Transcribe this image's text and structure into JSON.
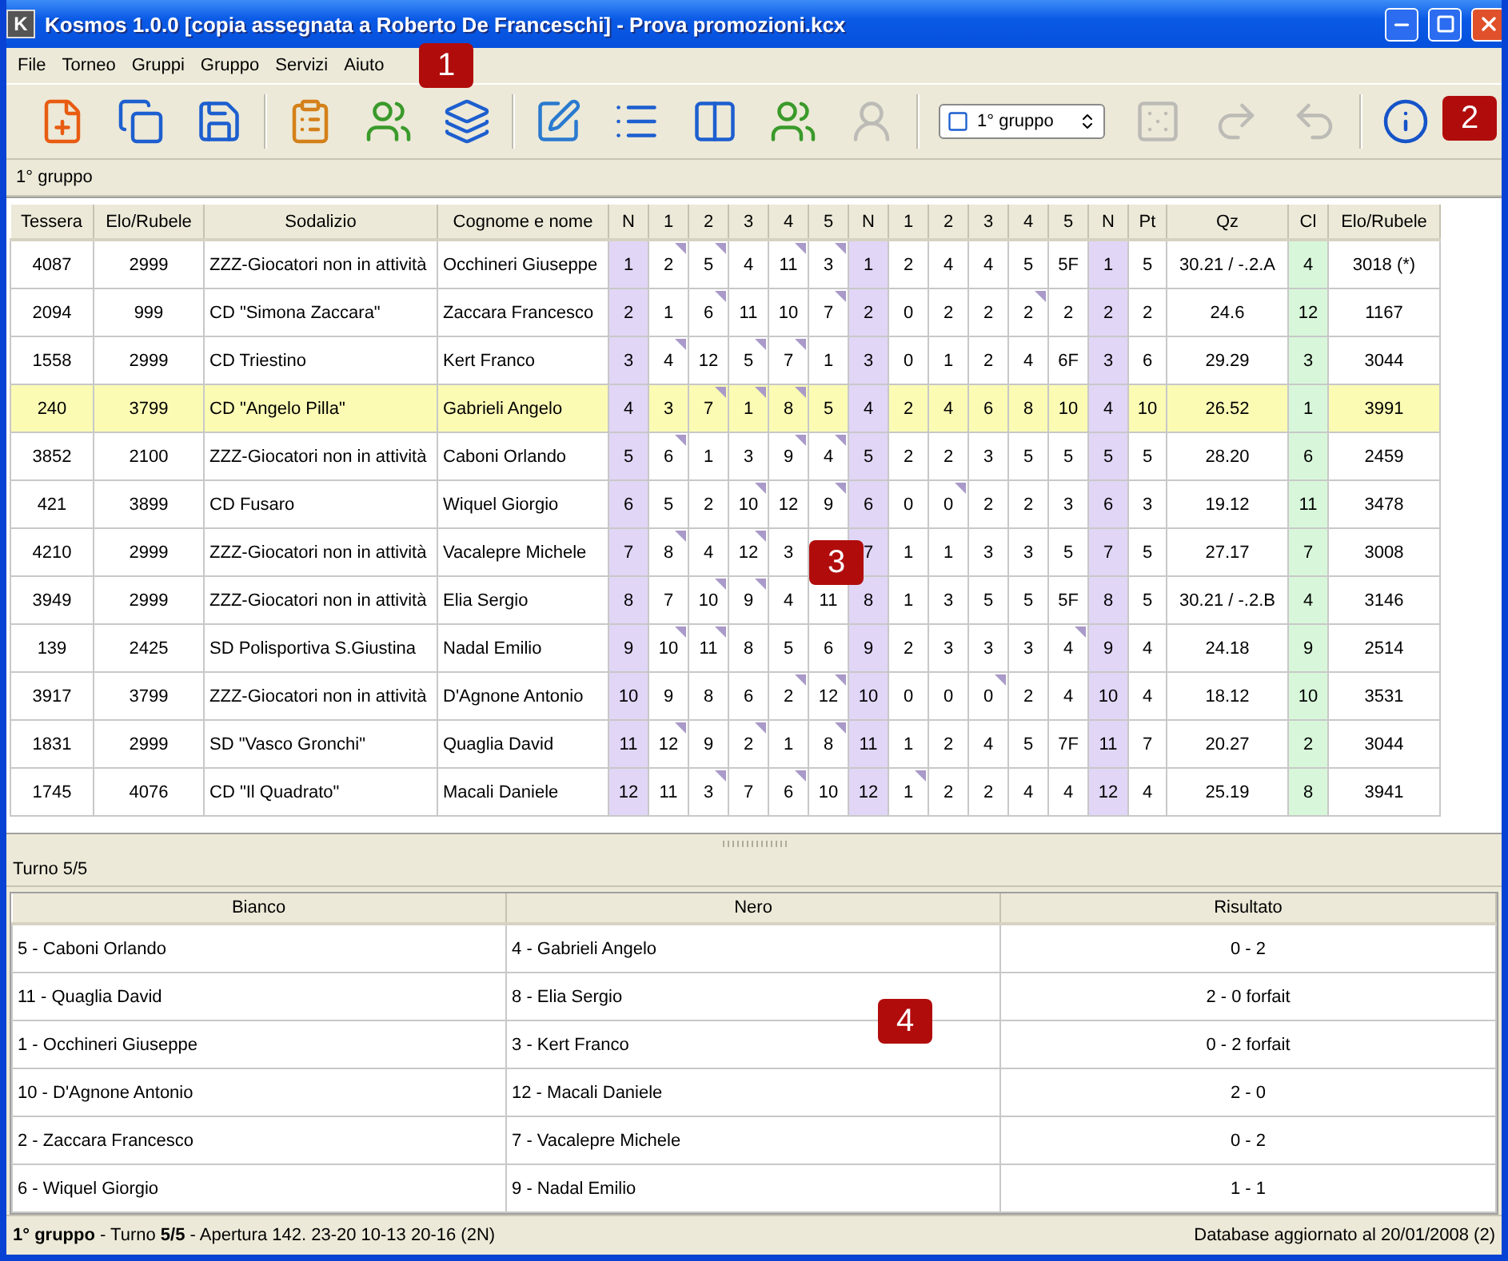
{
  "window": {
    "icon_letter": "K",
    "title": "Kosmos 1.0.0 [copia assegnata a Roberto De Franceschi] - Prova promozioni.kcx"
  },
  "menu": [
    "File",
    "Torneo",
    "Gruppi",
    "Gruppo",
    "Servizi",
    "Aiuto"
  ],
  "toolbar": [
    {
      "kind": "button",
      "disabled": false
    },
    {
      "kind": "button",
      "disabled": false
    },
    {
      "kind": "button",
      "disabled": false
    },
    {
      "kind": "separator"
    },
    {
      "kind": "button",
      "disabled": false
    },
    {
      "kind": "button",
      "disabled": false
    },
    {
      "kind": "button",
      "disabled": false
    },
    {
      "kind": "separator"
    },
    {
      "kind": "button",
      "disabled": false
    },
    {
      "kind": "button",
      "disabled": false
    },
    {
      "kind": "button",
      "disabled": false
    },
    {
      "kind": "button",
      "disabled": false
    },
    {
      "kind": "button",
      "disabled": true
    },
    {
      "kind": "separator"
    },
    {
      "kind": "combo",
      "value": "1° gruppo"
    },
    {
      "kind": "button",
      "disabled": true
    },
    {
      "kind": "button",
      "disabled": true
    },
    {
      "kind": "button",
      "disabled": true
    },
    {
      "kind": "separator"
    },
    {
      "kind": "button",
      "disabled": false
    }
  ],
  "callouts": [
    "1",
    "2",
    "3",
    "4"
  ],
  "group_label": "1° gruppo",
  "standings": {
    "columns": [
      "Tessera",
      "Elo/Rubele",
      "Sodalizio",
      "Cognome e nome",
      "N",
      "1",
      "2",
      "3",
      "4",
      "5",
      "N",
      "1",
      "2",
      "3",
      "4",
      "5",
      "N",
      "Pt",
      "Qz",
      "Cl",
      "Elo/Rubele"
    ],
    "rows": [
      {
        "selected": false,
        "tessera": "4087",
        "elo": "2999",
        "club": "ZZZ-Giocatori non in attività",
        "name": "Occhineri Giuseppe",
        "n": [
          "1",
          "1",
          "1"
        ],
        "opponents": [
          {
            "value": "2",
            "marked": true
          },
          {
            "value": "5",
            "marked": true
          },
          {
            "value": "4",
            "marked": false
          },
          {
            "value": "11",
            "marked": true
          },
          {
            "value": "3",
            "marked": true
          }
        ],
        "points": [
          {
            "value": "2",
            "marked": false
          },
          {
            "value": "4",
            "marked": false
          },
          {
            "value": "4",
            "marked": false
          },
          {
            "value": "5",
            "marked": false
          },
          {
            "value": "5F",
            "marked": false
          }
        ],
        "pt": "5",
        "qz": "30.21 / -.2.A",
        "cl": "4",
        "elo_new": "3018 (*)"
      },
      {
        "selected": false,
        "tessera": "2094",
        "elo": "999",
        "club": "CD \"Simona Zaccara\"",
        "name": "Zaccara Francesco",
        "n": [
          "2",
          "2",
          "2"
        ],
        "opponents": [
          {
            "value": "1",
            "marked": false
          },
          {
            "value": "6",
            "marked": true
          },
          {
            "value": "11",
            "marked": false
          },
          {
            "value": "10",
            "marked": false
          },
          {
            "value": "7",
            "marked": true
          }
        ],
        "points": [
          {
            "value": "0",
            "marked": false
          },
          {
            "value": "2",
            "marked": false
          },
          {
            "value": "2",
            "marked": false
          },
          {
            "value": "2",
            "marked": true
          },
          {
            "value": "2",
            "marked": false
          }
        ],
        "pt": "2",
        "qz": "24.6",
        "cl": "12",
        "elo_new": "1167"
      },
      {
        "selected": false,
        "tessera": "1558",
        "elo": "2999",
        "club": "CD Triestino",
        "name": "Kert Franco",
        "n": [
          "3",
          "3",
          "3"
        ],
        "opponents": [
          {
            "value": "4",
            "marked": true
          },
          {
            "value": "12",
            "marked": false
          },
          {
            "value": "5",
            "marked": true
          },
          {
            "value": "7",
            "marked": true
          },
          {
            "value": "1",
            "marked": false
          }
        ],
        "points": [
          {
            "value": "0",
            "marked": false
          },
          {
            "value": "1",
            "marked": false
          },
          {
            "value": "2",
            "marked": false
          },
          {
            "value": "4",
            "marked": false
          },
          {
            "value": "6F",
            "marked": false
          }
        ],
        "pt": "6",
        "qz": "29.29",
        "cl": "3",
        "elo_new": "3044"
      },
      {
        "selected": true,
        "tessera": "240",
        "elo": "3799",
        "club": "CD \"Angelo Pilla\"",
        "name": "Gabrieli Angelo",
        "n": [
          "4",
          "4",
          "4"
        ],
        "opponents": [
          {
            "value": "3",
            "marked": false
          },
          {
            "value": "7",
            "marked": true
          },
          {
            "value": "1",
            "marked": true
          },
          {
            "value": "8",
            "marked": true
          },
          {
            "value": "5",
            "marked": false
          }
        ],
        "points": [
          {
            "value": "2",
            "marked": false
          },
          {
            "value": "4",
            "marked": false
          },
          {
            "value": "6",
            "marked": false
          },
          {
            "value": "8",
            "marked": false
          },
          {
            "value": "10",
            "marked": false
          }
        ],
        "pt": "10",
        "qz": "26.52",
        "cl": "1",
        "elo_new": "3991"
      },
      {
        "selected": false,
        "tessera": "3852",
        "elo": "2100",
        "club": "ZZZ-Giocatori non in attività",
        "name": "Caboni Orlando",
        "n": [
          "5",
          "5",
          "5"
        ],
        "opponents": [
          {
            "value": "6",
            "marked": true
          },
          {
            "value": "1",
            "marked": false
          },
          {
            "value": "3",
            "marked": false
          },
          {
            "value": "9",
            "marked": true
          },
          {
            "value": "4",
            "marked": true
          }
        ],
        "points": [
          {
            "value": "2",
            "marked": false
          },
          {
            "value": "2",
            "marked": false
          },
          {
            "value": "3",
            "marked": false
          },
          {
            "value": "5",
            "marked": false
          },
          {
            "value": "5",
            "marked": false
          }
        ],
        "pt": "5",
        "qz": "28.20",
        "cl": "6",
        "elo_new": "2459"
      },
      {
        "selected": false,
        "tessera": "421",
        "elo": "3899",
        "club": "CD Fusaro",
        "name": "Wiquel Giorgio",
        "n": [
          "6",
          "6",
          "6"
        ],
        "opponents": [
          {
            "value": "5",
            "marked": false
          },
          {
            "value": "2",
            "marked": false
          },
          {
            "value": "10",
            "marked": true
          },
          {
            "value": "12",
            "marked": false
          },
          {
            "value": "9",
            "marked": true
          }
        ],
        "points": [
          {
            "value": "0",
            "marked": false
          },
          {
            "value": "0",
            "marked": true
          },
          {
            "value": "2",
            "marked": false
          },
          {
            "value": "2",
            "marked": false
          },
          {
            "value": "3",
            "marked": false
          }
        ],
        "pt": "3",
        "qz": "19.12",
        "cl": "11",
        "elo_new": "3478"
      },
      {
        "selected": false,
        "tessera": "4210",
        "elo": "2999",
        "club": "ZZZ-Giocatori non in attività",
        "name": "Vacalepre Michele",
        "n": [
          "7",
          "7",
          "7"
        ],
        "opponents": [
          {
            "value": "8",
            "marked": true
          },
          {
            "value": "4",
            "marked": false
          },
          {
            "value": "12",
            "marked": true
          },
          {
            "value": "3",
            "marked": false
          }
        ],
        "points": [
          {
            "value": "1",
            "marked": false
          },
          {
            "value": "1",
            "marked": false
          },
          {
            "value": "3",
            "marked": false
          },
          {
            "value": "3",
            "marked": false
          },
          {
            "value": "5",
            "marked": false
          }
        ],
        "pt": "5",
        "qz": "27.17",
        "cl": "7",
        "elo_new": "3008"
      },
      {
        "selected": false,
        "tessera": "3949",
        "elo": "2999",
        "club": "ZZZ-Giocatori non in attività",
        "name": "Elia Sergio",
        "n": [
          "8",
          "8",
          "8"
        ],
        "opponents": [
          {
            "value": "7",
            "marked": false
          },
          {
            "value": "10",
            "marked": true
          },
          {
            "value": "9",
            "marked": true
          },
          {
            "value": "4",
            "marked": false
          },
          {
            "value": "11",
            "marked": false
          }
        ],
        "points": [
          {
            "value": "1",
            "marked": false
          },
          {
            "value": "3",
            "marked": false
          },
          {
            "value": "5",
            "marked": false
          },
          {
            "value": "5",
            "marked": false
          },
          {
            "value": "5F",
            "marked": false
          }
        ],
        "pt": "5",
        "qz": "30.21 / -.2.B",
        "cl": "4",
        "elo_new": "3146"
      },
      {
        "selected": false,
        "tessera": "139",
        "elo": "2425",
        "club": "SD Polisportiva S.Giustina",
        "name": "Nadal Emilio",
        "n": [
          "9",
          "9",
          "9"
        ],
        "opponents": [
          {
            "value": "10",
            "marked": true
          },
          {
            "value": "11",
            "marked": true
          },
          {
            "value": "8",
            "marked": false
          },
          {
            "value": "5",
            "marked": false
          },
          {
            "value": "6",
            "marked": false
          }
        ],
        "points": [
          {
            "value": "2",
            "marked": false
          },
          {
            "value": "3",
            "marked": false
          },
          {
            "value": "3",
            "marked": false
          },
          {
            "value": "3",
            "marked": false
          },
          {
            "value": "4",
            "marked": true
          }
        ],
        "pt": "4",
        "qz": "24.18",
        "cl": "9",
        "elo_new": "2514"
      },
      {
        "selected": false,
        "tessera": "3917",
        "elo": "3799",
        "club": "ZZZ-Giocatori non in attività",
        "name": "D'Agnone Antonio",
        "n": [
          "10",
          "10",
          "10"
        ],
        "opponents": [
          {
            "value": "9",
            "marked": false
          },
          {
            "value": "8",
            "marked": false
          },
          {
            "value": "6",
            "marked": false
          },
          {
            "value": "2",
            "marked": true
          },
          {
            "value": "12",
            "marked": true
          }
        ],
        "points": [
          {
            "value": "0",
            "marked": false
          },
          {
            "value": "0",
            "marked": false
          },
          {
            "value": "0",
            "marked": true
          },
          {
            "value": "2",
            "marked": false
          },
          {
            "value": "4",
            "marked": false
          }
        ],
        "pt": "4",
        "qz": "18.12",
        "cl": "10",
        "elo_new": "3531"
      },
      {
        "selected": false,
        "tessera": "1831",
        "elo": "2999",
        "club": "SD \"Vasco Gronchi\"",
        "name": "Quaglia David",
        "n": [
          "11",
          "11",
          "11"
        ],
        "opponents": [
          {
            "value": "12",
            "marked": true
          },
          {
            "value": "9",
            "marked": false
          },
          {
            "value": "2",
            "marked": true
          },
          {
            "value": "1",
            "marked": false
          },
          {
            "value": "8",
            "marked": true
          }
        ],
        "points": [
          {
            "value": "1",
            "marked": false
          },
          {
            "value": "2",
            "marked": false
          },
          {
            "value": "4",
            "marked": false
          },
          {
            "value": "5",
            "marked": false
          },
          {
            "value": "7F",
            "marked": false
          }
        ],
        "pt": "7",
        "qz": "20.27",
        "cl": "2",
        "elo_new": "3044"
      },
      {
        "selected": false,
        "tessera": "1745",
        "elo": "4076",
        "club": "CD \"Il Quadrato\"",
        "name": "Macali Daniele",
        "n": [
          "12",
          "12",
          "12"
        ],
        "opponents": [
          {
            "value": "11",
            "marked": false
          },
          {
            "value": "3",
            "marked": true
          },
          {
            "value": "7",
            "marked": false
          },
          {
            "value": "6",
            "marked": true
          },
          {
            "value": "10",
            "marked": false
          }
        ],
        "points": [
          {
            "value": "1",
            "marked": true
          },
          {
            "value": "2",
            "marked": false
          },
          {
            "value": "2",
            "marked": false
          },
          {
            "value": "4",
            "marked": false
          },
          {
            "value": "4",
            "marked": false
          }
        ],
        "pt": "4",
        "qz": "25.19",
        "cl": "8",
        "elo_new": "3941"
      }
    ]
  },
  "round_label": "Turno 5/5",
  "pairings": {
    "columns": [
      "Bianco",
      "Nero",
      "Risultato"
    ],
    "rows": [
      {
        "white": "5 - Caboni Orlando",
        "black": "4 - Gabrieli Angelo",
        "result": "0 - 2"
      },
      {
        "white": "11 - Quaglia David",
        "black": "8 - Elia Sergio",
        "result": "2 - 0 forfait"
      },
      {
        "white": "1 - Occhineri Giuseppe",
        "black": "3 - Kert Franco",
        "result": "0 - 2 forfait"
      },
      {
        "white": "10 - D'Agnone Antonio",
        "black": "12 - Macali Daniele",
        "result": "2 - 0"
      },
      {
        "white": "2 - Zaccara Francesco",
        "black": "7 - Vacalepre Michele",
        "result": "0 - 2"
      },
      {
        "white": "6 - Wiquel Giorgio",
        "black": "9 - Nadal Emilio",
        "result": "1 - 1"
      }
    ]
  },
  "status_bar": {
    "left": "**1° gruppo** - Turno **5/5** - Apertura 142. 23-20 10-13 20-16 (2N)",
    "right": "Database aggiornato al 20/01/2008 (2)"
  }
}
